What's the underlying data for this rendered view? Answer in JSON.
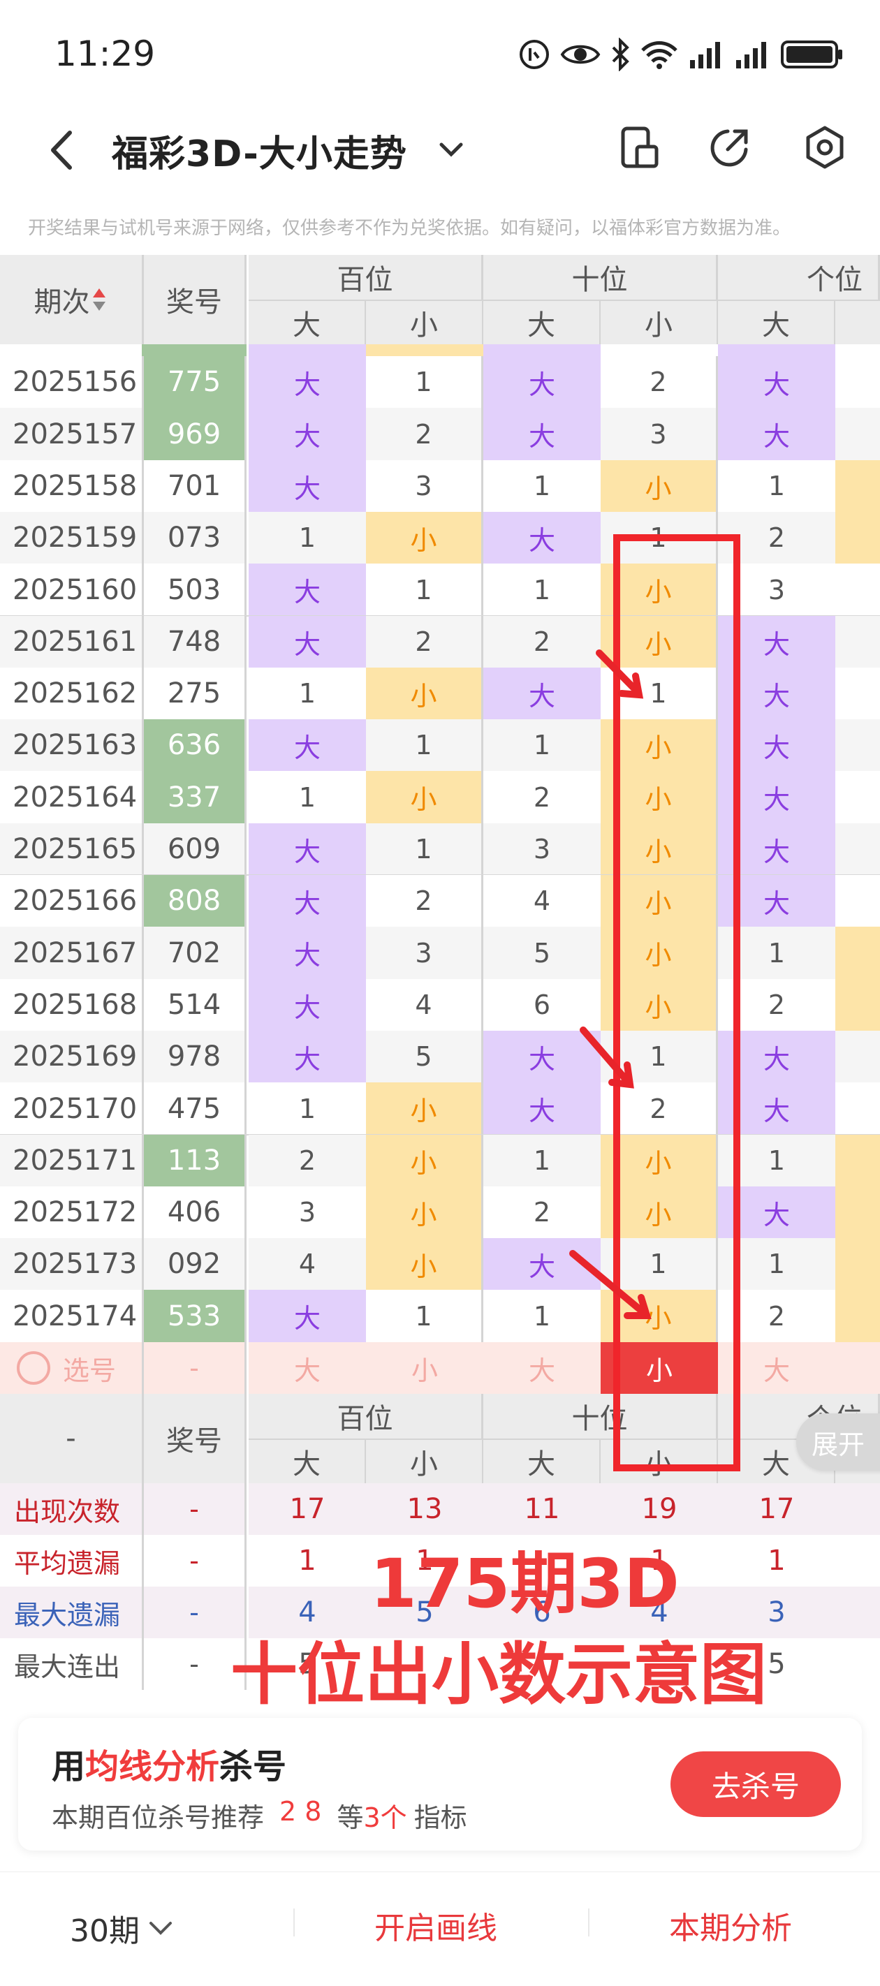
{
  "status_bar": {
    "time": "11:29"
  },
  "header": {
    "title": "福彩3D-大小走势",
    "icons": [
      "back-icon",
      "chevron-down-icon",
      "phone-icon",
      "share-icon",
      "settings-icon"
    ]
  },
  "notice": "开奖结果与试机号来源于网络，仅供参考不作为兑奖依据。如有疑问，以福体彩官方数据为准。",
  "table": {
    "col_period": "期次",
    "col_number": "奖号",
    "group_labels": [
      "百位",
      "十位",
      "个位"
    ],
    "sub_labels": [
      "大",
      "小",
      "大",
      "小",
      "大"
    ],
    "big_label": "大",
    "small_label": "小",
    "rows": [
      {
        "period": "2025156",
        "number": "775",
        "hl": true,
        "cells": [
          "大",
          "1",
          "大",
          "2",
          "大"
        ]
      },
      {
        "period": "2025157",
        "number": "969",
        "hl": true,
        "cells": [
          "大",
          "2",
          "大",
          "3",
          "大"
        ]
      },
      {
        "period": "2025158",
        "number": "701",
        "hl": false,
        "cells": [
          "大",
          "3",
          "1",
          "小",
          "1"
        ]
      },
      {
        "period": "2025159",
        "number": "073",
        "hl": false,
        "cells": [
          "1",
          "小",
          "大",
          "1",
          "2"
        ]
      },
      {
        "period": "2025160",
        "number": "503",
        "hl": false,
        "cells": [
          "大",
          "1",
          "1",
          "小",
          "3"
        ]
      },
      {
        "period": "2025161",
        "number": "748",
        "hl": false,
        "cells": [
          "大",
          "2",
          "2",
          "小",
          "大"
        ]
      },
      {
        "period": "2025162",
        "number": "275",
        "hl": false,
        "cells": [
          "1",
          "小",
          "大",
          "1",
          "大"
        ]
      },
      {
        "period": "2025163",
        "number": "636",
        "hl": true,
        "cells": [
          "大",
          "1",
          "1",
          "小",
          "大"
        ]
      },
      {
        "period": "2025164",
        "number": "337",
        "hl": true,
        "cells": [
          "1",
          "小",
          "2",
          "小",
          "大"
        ]
      },
      {
        "period": "2025165",
        "number": "609",
        "hl": false,
        "cells": [
          "大",
          "1",
          "3",
          "小",
          "大"
        ]
      },
      {
        "period": "2025166",
        "number": "808",
        "hl": true,
        "cells": [
          "大",
          "2",
          "4",
          "小",
          "大"
        ]
      },
      {
        "period": "2025167",
        "number": "702",
        "hl": false,
        "cells": [
          "大",
          "3",
          "5",
          "小",
          "1"
        ]
      },
      {
        "period": "2025168",
        "number": "514",
        "hl": false,
        "cells": [
          "大",
          "4",
          "6",
          "小",
          "2"
        ]
      },
      {
        "period": "2025169",
        "number": "978",
        "hl": false,
        "cells": [
          "大",
          "5",
          "大",
          "1",
          "大"
        ]
      },
      {
        "period": "2025170",
        "number": "475",
        "hl": false,
        "cells": [
          "1",
          "小",
          "大",
          "2",
          "大"
        ]
      },
      {
        "period": "2025171",
        "number": "113",
        "hl": true,
        "cells": [
          "2",
          "小",
          "1",
          "小",
          "1"
        ]
      },
      {
        "period": "2025172",
        "number": "406",
        "hl": false,
        "cells": [
          "3",
          "小",
          "2",
          "小",
          "大"
        ]
      },
      {
        "period": "2025173",
        "number": "092",
        "hl": false,
        "cells": [
          "4",
          "小",
          "大",
          "1",
          "1"
        ]
      },
      {
        "period": "2025174",
        "number": "533",
        "hl": true,
        "cells": [
          "大",
          "1",
          "1",
          "小",
          "2"
        ]
      }
    ],
    "select_row": {
      "label": "选号",
      "number": "-",
      "cells": [
        "大",
        "小",
        "大",
        "小",
        "大"
      ]
    },
    "footer_col_period": "-",
    "footer_col_number": "奖号",
    "expand_label": "展开",
    "stats": [
      {
        "label": "出现次数",
        "number": "-",
        "values": [
          "17",
          "13",
          "11",
          "19",
          "17"
        ],
        "color": "#c8232b"
      },
      {
        "label": "平均遗漏",
        "number": "-",
        "values": [
          "1",
          "1",
          "",
          "1",
          "1"
        ],
        "color": "#c8232b"
      },
      {
        "label": "最大遗漏",
        "number": "-",
        "values": [
          "4",
          "5",
          "6",
          "4",
          "3"
        ],
        "color": "#3a62b8"
      },
      {
        "label": "最大连出",
        "number": "-",
        "values": [
          "5",
          "",
          "",
          "",
          "5"
        ],
        "color": "#555555"
      }
    ]
  },
  "annotation": {
    "line1": "175期3D",
    "line2": "十位出小数示意图"
  },
  "promo": {
    "title_prefix": "用",
    "title_highlight": "均线分析",
    "title_suffix": "杀号",
    "sub_prefix": "本期百位杀号推荐",
    "sub_numbers": "2 8",
    "sub_mid": "等",
    "sub_count": "3个",
    "sub_suffix": "指标",
    "button": "去杀号"
  },
  "tabbar": {
    "periods": "30期",
    "draw_line": "开启画线",
    "analysis": "本期分析"
  },
  "colors": {
    "accent": "#f03c3c",
    "big_bg": "#e2d0fb",
    "small_bg": "#fde4a8",
    "hl_bg": "#a2c69d"
  }
}
